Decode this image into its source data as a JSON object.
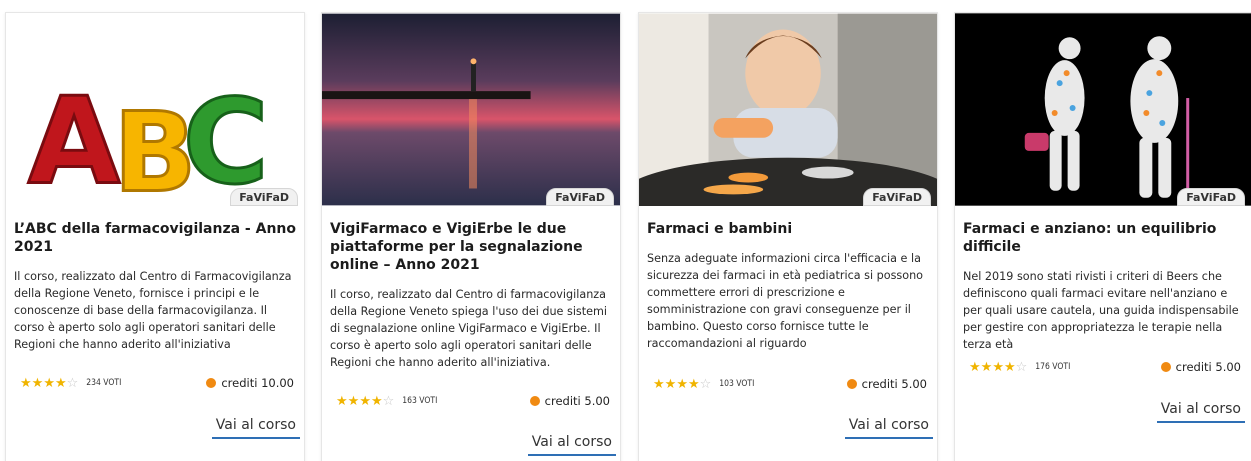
{
  "cards": [
    {
      "badge": "FaViFaD",
      "title": "L’ABC della farmacovigilanza - Anno 2021",
      "description": "Il corso, realizzato dal Centro di Farmacovigilanza della Regione Veneto, fornisce i principi e le conoscenze di base della farmacovigilanza. Il corso è aperto solo agli operatori sanitari delle Regioni che hanno aderito all'iniziativa",
      "rating": 4,
      "votes": "234 VOTI",
      "credits": "crediti 10.00",
      "cta": "Vai al corso"
    },
    {
      "badge": "FaViFaD",
      "title": "VigiFarmaco e VigiErbe le due piattaforme per la segnalazione online – Anno 2021",
      "description": "Il corso, realizzato dal Centro di farmacovigilanza della Regione Veneto spiega l'uso dei due sistemi di segnalazione online VigiFarmaco e VigiErbe. Il corso è aperto solo agli operatori sanitari delle Regioni che hanno aderito all'iniziativa.",
      "rating": 4,
      "votes": "163 VOTI",
      "credits": "crediti 5.00",
      "cta": "Vai al corso"
    },
    {
      "badge": "FaViFaD",
      "title": "Farmaci e bambini",
      "description": "Senza adeguate informazioni circa l'efficacia e la sicurezza dei farmaci in età pediatrica si possono commettere errori di prescrizione e somministrazione con gravi conseguenze per il bambino. Questo corso fornisce tutte le raccomandazioni al riguardo",
      "rating": 4,
      "votes": "103 VOTI",
      "credits": "crediti 5.00",
      "cta": "Vai al corso"
    },
    {
      "badge": "FaViFaD",
      "title": "Farmaci e anziano: un equilibrio difficile",
      "description": "Nel 2019 sono stati rivisti i criteri di Beers che definiscono quali farmaci evitare nell'anziano e per quali usare cautela, una guida indispensabile per gestire con appropriatezza le terapie nella terza età",
      "rating": 4,
      "votes": "176 VOTI",
      "credits": "crediti 5.00",
      "cta": "Vai al corso"
    }
  ],
  "colors": {
    "star": "#f0b400",
    "credit_dot": "#f08a12",
    "cta_underline": "#2e6fb5"
  },
  "logo_text": "ABC"
}
